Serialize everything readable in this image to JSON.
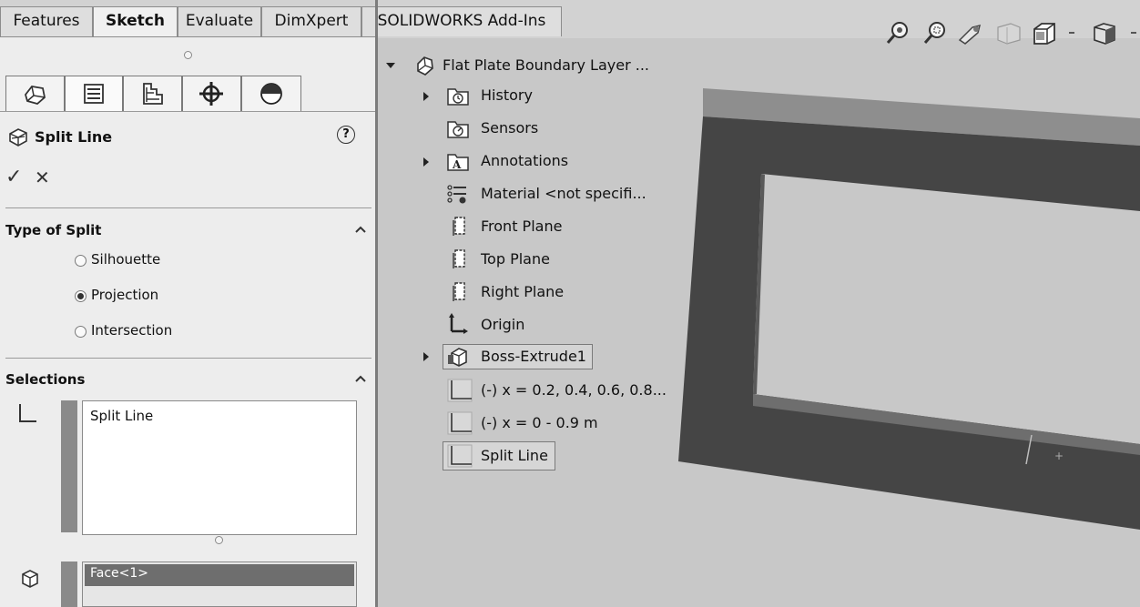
{
  "command_tabs": [
    "Features",
    "Sketch",
    "Evaluate",
    "DimXpert",
    "SOLIDWORKS Add-Ins"
  ],
  "active_tab": "Sketch",
  "property_manager": {
    "title": "Split Line",
    "help_symbol": "?",
    "ok_symbol": "✓",
    "cancel_symbol": "✕",
    "type_of_split": {
      "heading": "Type of Split",
      "options": [
        "Silhouette",
        "Projection",
        "Intersection"
      ],
      "selected": "Projection"
    },
    "selections": {
      "heading": "Selections",
      "sketch_list": [
        "Split Line"
      ],
      "face_list": [
        "Face<1>"
      ]
    }
  },
  "feature_tree": {
    "root": "Flat Plate Boundary Layer ...",
    "items": [
      {
        "label": "History"
      },
      {
        "label": "Sensors"
      },
      {
        "label": "Annotations"
      },
      {
        "label": "Material <not specifi..."
      },
      {
        "label": "Front Plane"
      },
      {
        "label": "Top Plane"
      },
      {
        "label": "Right Plane"
      },
      {
        "label": "Origin"
      },
      {
        "label": "Boss-Extrude1"
      },
      {
        "label": "(-) x = 0.2, 0.4, 0.6, 0.8..."
      },
      {
        "label": "(-) x = 0 - 0.9 m"
      },
      {
        "label": "Split Line"
      }
    ]
  },
  "icons": {
    "hud": [
      "zoom-to-fit-icon",
      "zoom-to-area-icon",
      "previous-view-icon",
      "section-view-icon",
      "view-orientation-icon",
      "display-style-icon"
    ],
    "pm_tabs": [
      "feature-manager-icon",
      "property-manager-icon",
      "configuration-manager-icon",
      "dimxpert-manager-icon",
      "display-manager-icon"
    ]
  },
  "colors": {
    "viewport_bg": "#c8c8c8",
    "part_dark": "#454545",
    "part_top": "#8e8e8e",
    "selection_bar": "#8a8a8a",
    "face_highlight": "#6e6e6e"
  }
}
